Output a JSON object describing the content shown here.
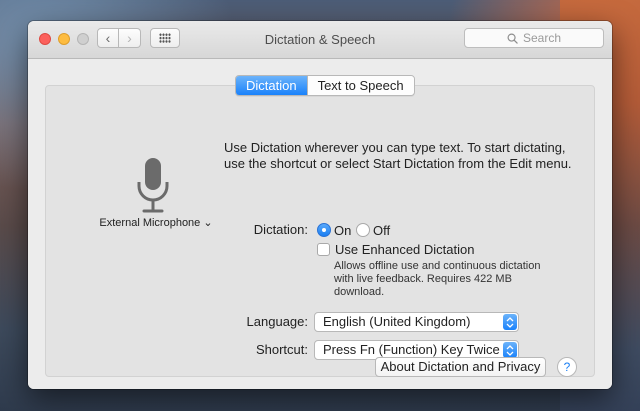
{
  "window": {
    "title": "Dictation & Speech",
    "search_placeholder": "Search"
  },
  "tabs": [
    {
      "label": "Dictation",
      "active": true
    },
    {
      "label": "Text to Speech",
      "active": false
    }
  ],
  "dictation": {
    "intro": "Use Dictation wherever you can type text. To start dictating, use the shortcut or select Start Dictation from the Edit menu.",
    "microphone_label": "External Microphone",
    "microphone_chevron": "⌄",
    "dictation_label": "Dictation:",
    "on_label": "On",
    "off_label": "Off",
    "dictation_on": true,
    "enhanced_label": "Use Enhanced Dictation",
    "enhanced_checked": false,
    "enhanced_note": "Allows offline use and continuous dictation with live feedback. Requires 422 MB download.",
    "language_label": "Language:",
    "language_value": "English (United Kingdom)",
    "shortcut_label": "Shortcut:",
    "shortcut_value": "Press Fn (Function) Key Twice",
    "about_button": "About Dictation and Privacy",
    "help_symbol": "?"
  },
  "nav": {
    "back_symbol": "‹",
    "forward_symbol": "›"
  },
  "colors": {
    "accent": "#1a82fb",
    "window_bg": "#ececec",
    "panel_bg": "#e3e3e3"
  }
}
